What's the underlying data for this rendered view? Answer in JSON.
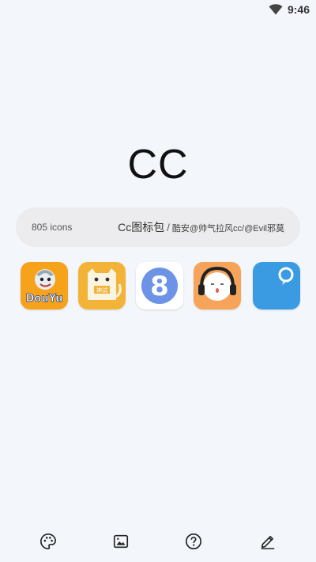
{
  "status_bar": {
    "time": "9:46",
    "wifi_icon": "wifi-icon"
  },
  "header": {
    "title": "CC"
  },
  "info_card": {
    "icon_count": "805 icons",
    "pack_name": "Cc图标包",
    "separator": "/",
    "authors": "酷安@帅气拉风cc/@Evil邪莫"
  },
  "preview_icons": [
    {
      "name": "douyu-icon",
      "label": "DouYu",
      "color": "#f7a21b"
    },
    {
      "name": "shenshi-cat-icon",
      "label": "神试",
      "color": "#f2b338"
    },
    {
      "name": "number-eight-icon",
      "label": "8",
      "color": "#6d93e6"
    },
    {
      "name": "headphone-face-icon",
      "label": "",
      "color": "#f5a45a"
    },
    {
      "name": "speech-bubble-icon",
      "label": "",
      "color": "#3a9be3"
    }
  ],
  "bottom_nav": [
    {
      "name": "palette-icon"
    },
    {
      "name": "wallpaper-icon"
    },
    {
      "name": "help-icon"
    },
    {
      "name": "edit-icon"
    }
  ]
}
